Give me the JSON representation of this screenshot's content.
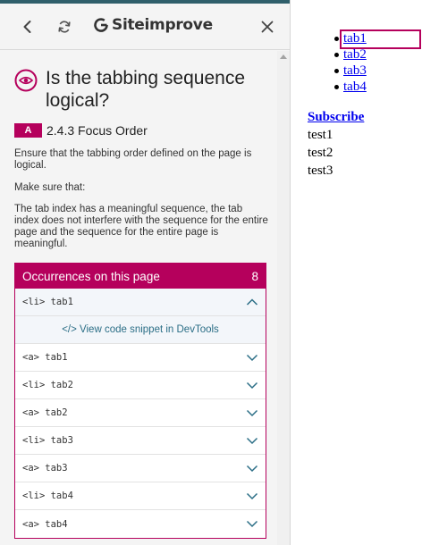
{
  "header": {
    "logo_text": "Siteimprove",
    "back_icon": "chevron-left-icon",
    "refresh_icon": "refresh-icon",
    "close_icon": "close-icon"
  },
  "issue": {
    "title": "Is the tabbing sequence logical?",
    "icon": "eye-icon",
    "level": "A",
    "criterion": "2.4.3 Focus Order",
    "description": "Ensure that the tabbing order defined on the page is logical.",
    "make_sure": "Make sure that:",
    "details": "The tab index has a meaningful sequence, the tab index does not interfere with the sequence for the entire page and the sequence for the entire page is meaningful."
  },
  "occurrences": {
    "title": "Occurrences on this page",
    "count": "8",
    "snippet_link": "</> View code snippet in DevTools",
    "items": [
      {
        "code": "<li>  tab1",
        "expanded": true
      },
      {
        "code": "<a>  tab1",
        "expanded": false
      },
      {
        "code": "<li>  tab2",
        "expanded": false
      },
      {
        "code": "<a>  tab2",
        "expanded": false
      },
      {
        "code": "<li>  tab3",
        "expanded": false
      },
      {
        "code": "<a>  tab3",
        "expanded": false
      },
      {
        "code": "<li>  tab4",
        "expanded": false
      },
      {
        "code": "<a>  tab4",
        "expanded": false
      }
    ]
  },
  "page": {
    "tabs": [
      "tab1",
      "tab2",
      "tab3",
      "tab4"
    ],
    "subscribe": "Subscribe",
    "tests": [
      "test1",
      "test2",
      "test3"
    ]
  },
  "colors": {
    "accent": "#b5005c",
    "link": "#0000ee",
    "snippet_link": "#2b6e86"
  }
}
